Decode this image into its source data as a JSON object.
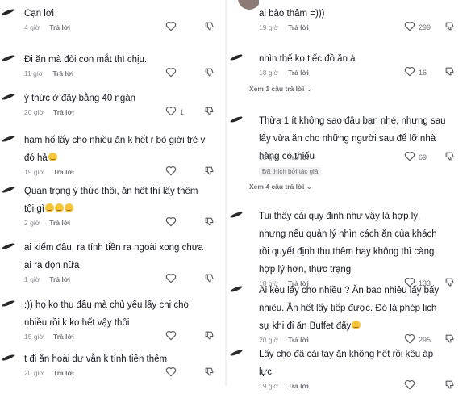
{
  "left": [
    {
      "text": [
        "Cạn lời"
      ],
      "time": "4 giờ",
      "reply": "Trả lời",
      "likes": "",
      "emoji": false
    },
    {
      "text": [
        "Đi ăn mà đòi con mắt thì chịu."
      ],
      "time": "11 giờ",
      "reply": "Trả lời",
      "likes": "",
      "emoji": false
    },
    {
      "text": [
        "ý thức ở đây bằng 40 ngàn"
      ],
      "time": "20 giờ",
      "reply": "Trả lời",
      "likes": "1",
      "emoji": false
    },
    {
      "text": [
        "ham hố lấy cho nhiều ăn k hết r bỏ giới trẻ v",
        "đó hả"
      ],
      "time": "19 giờ",
      "reply": "Trả lời",
      "likes": "",
      "emoji": true
    },
    {
      "text": [
        "Quan trọng ý thức thôi, ăn hết thì lấy thêm",
        "tội gì"
      ],
      "time": "2 giờ",
      "reply": "Trả lời",
      "likes": "",
      "emoji": true
    },
    {
      "text": [
        "ai kiếm đâu, ra tính tiền ra ngoài xong chưa",
        "ai ra dọn nữa"
      ],
      "time": "1 giờ",
      "reply": "Trả lời",
      "likes": "",
      "emoji": false
    },
    {
      "text": [
        ":)) họ ko thu đâu mà chủ yếu lấy chi cho",
        "nhiều rồi k   ko hết vậy thôi"
      ],
      "time": "15 giờ",
      "reply": "Trả lời",
      "likes": "",
      "emoji": false
    },
    {
      "text": [
        "t đi ăn hoài dư vẫn k tính tiền thêm"
      ],
      "time": "20 giờ",
      "reply": "Trả lời",
      "likes": "",
      "emoji": false
    }
  ],
  "right": [
    {
      "text": [
        "ai bảo thâm =)))"
      ],
      "time": "19 giờ",
      "reply": "Trả lời",
      "likes": "299",
      "emoji": false
    },
    {
      "text": [
        "nhìn thế ko tiếc đồ ăn à"
      ],
      "time": "18 giờ",
      "reply": "Trả lời",
      "likes": "16",
      "emoji": false,
      "view_replies": "Xem 1 câu trả lời"
    },
    {
      "text": [
        "Thừa 1 ít không sao đâu bạn nhé, nhưng sau",
        "lấy vừa ăn cho những người sau để lỡ nhà",
        "hàng có thiếu"
      ],
      "time": "18 giờ",
      "reply": "Trả lời",
      "likes": "69",
      "emoji": false,
      "badge": "Đã thích bởi tác giả",
      "view_replies": "Xem 4 câu trả lời"
    },
    {
      "text": [
        "Tui thấy cái quy định như vậy là hợp lý,",
        "nhưng nếu quản lý nhìn cách ăn của khách",
        "rồi quyết định thu thêm hay không thì càng",
        "hợp lý hơn, thực trạng"
      ],
      "time": "18 giờ",
      "reply": "Trả lời",
      "likes": "133",
      "emoji": false
    },
    {
      "text": [
        "Ai kêu lấy cho nhiều ? Ăn bao nhiêu lấy bấy",
        "nhiêu. Ăn hết lấy tiếp được. Đó là phép lịch",
        "sự khi đi ăn Buffet đấy"
      ],
      "time": "20 giờ",
      "reply": "Trả lời",
      "likes": "295",
      "emoji": true
    },
    {
      "text": [
        "Lấy cho đã cái tay ăn không hết rồi kêu áp",
        "lực"
      ],
      "time": "19 giờ",
      "reply": "Trả lời",
      "likes": "",
      "emoji": false
    }
  ]
}
